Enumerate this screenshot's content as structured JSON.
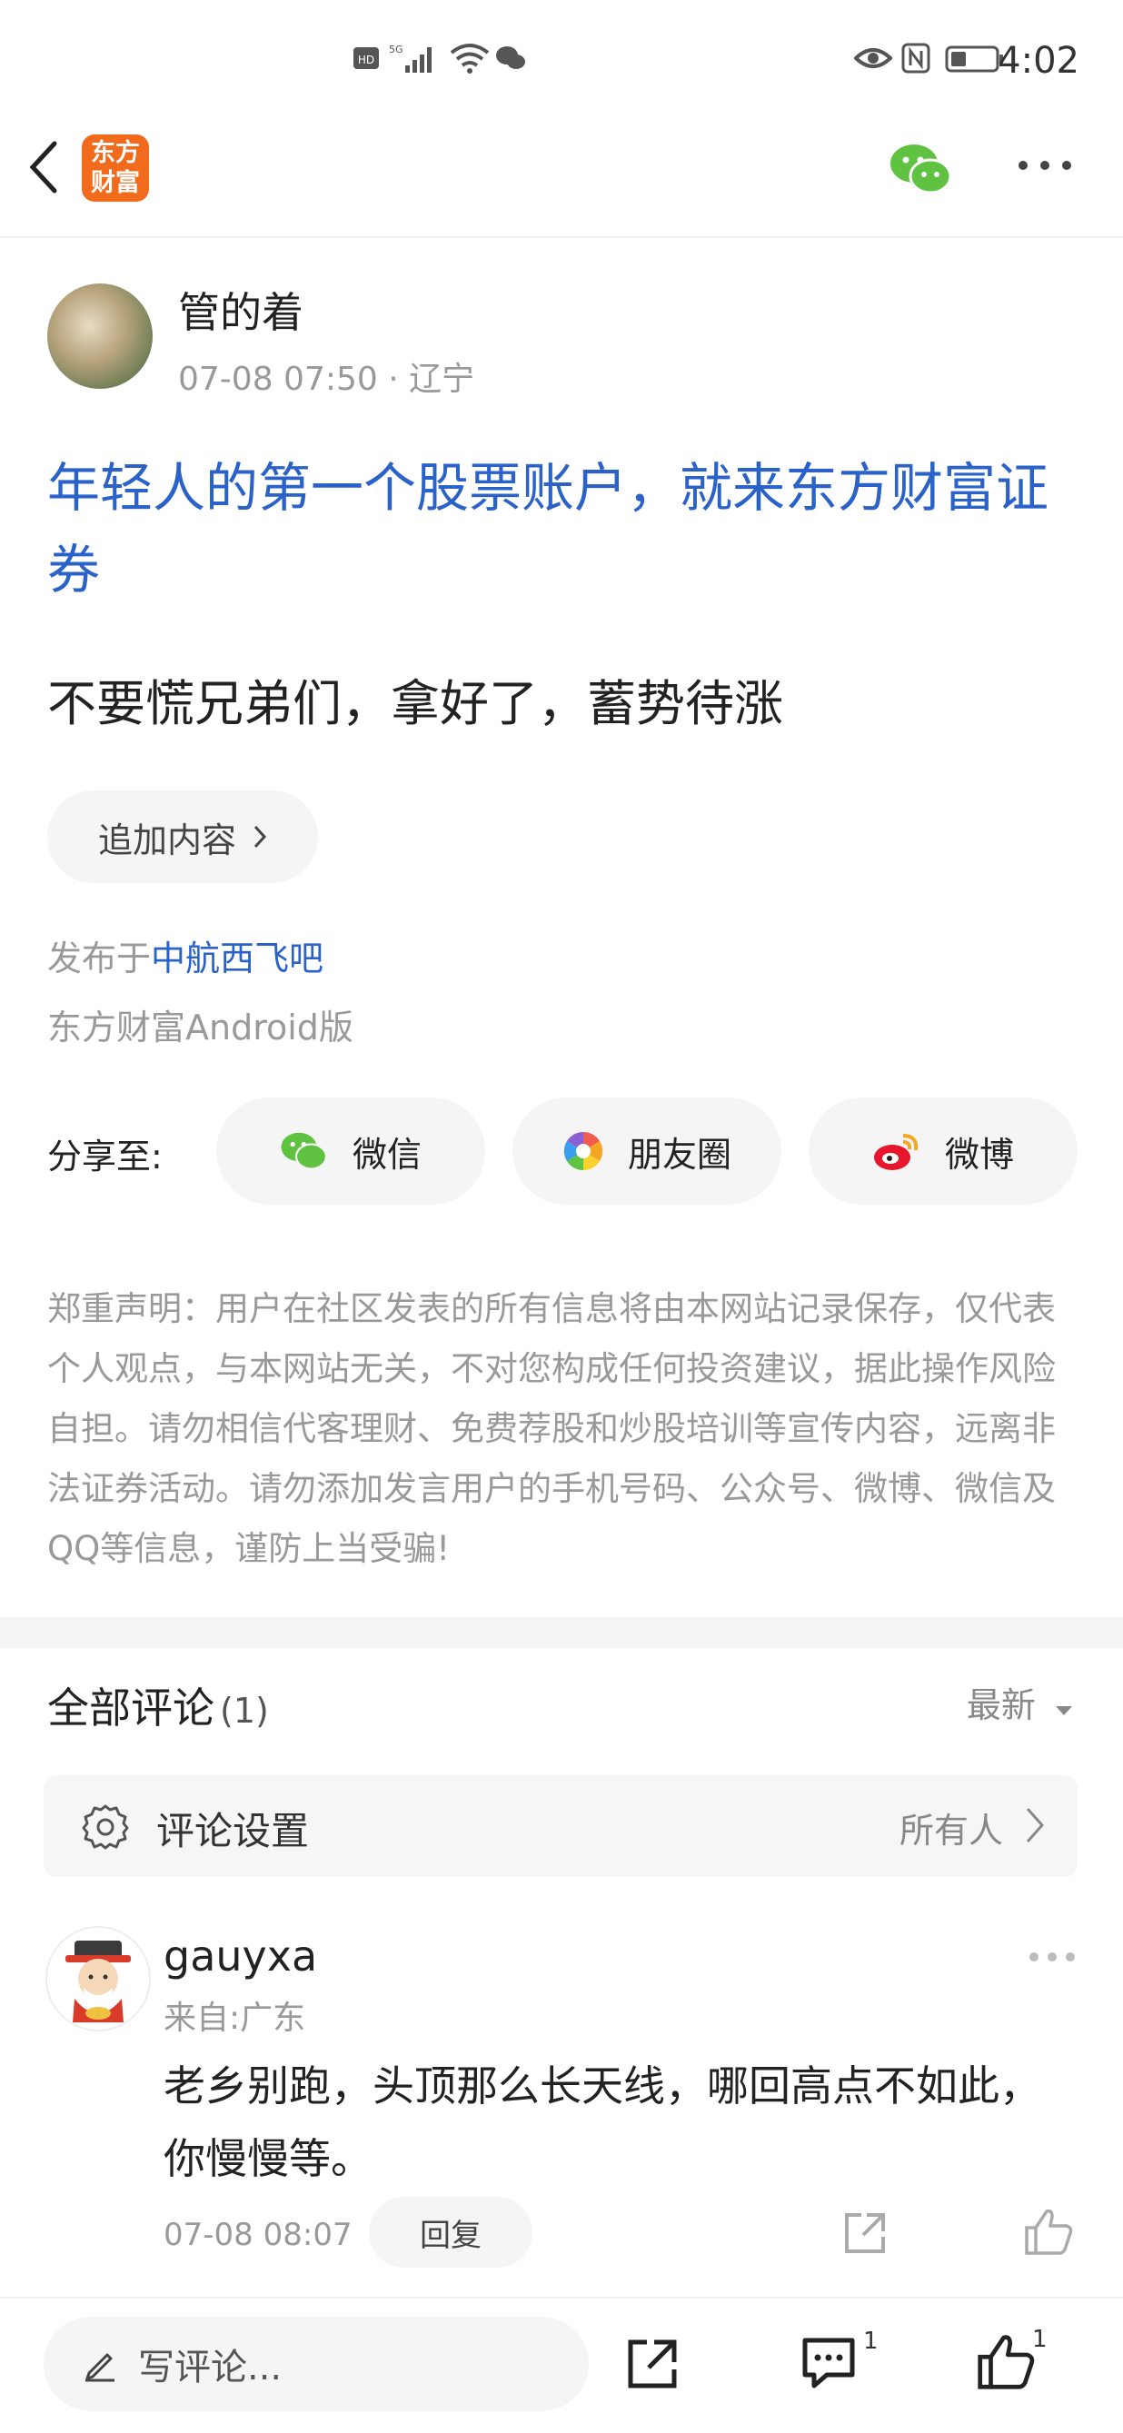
{
  "status_bar": {
    "time": "4:02",
    "network": "5G"
  },
  "header": {
    "logo_line1": "东方",
    "logo_line2": "财富",
    "back_icon": "chevron-left-icon",
    "wechat_icon": "wechat-icon",
    "more_icon": "more-horizontal-icon"
  },
  "post": {
    "author": "管的着",
    "time": "07-08 07:50",
    "location": "辽宁",
    "title": "年轻人的第一个股票账户，就来东方财富证券",
    "body": "不要慌兄弟们，拿好了，蓄势待涨",
    "add_content_label": "追加内容",
    "published_prefix": "发布于",
    "forum": "中航西飞吧",
    "client": "东方财富Android版"
  },
  "share": {
    "label": "分享至:",
    "wechat": "微信",
    "moments": "朋友圈",
    "weibo": "微博"
  },
  "disclaimer": "郑重声明：用户在社区发表的所有信息将由本网站记录保存，仅代表个人观点，与本网站无关，不对您构成任何投资建议，据此操作风险自担。请勿相信代客理财、免费荐股和炒股培训等宣传内容，远离非法证券活动。请勿添加发言用户的手机号码、公众号、微博、微信及QQ等信息，谨防上当受骗!",
  "comments": {
    "title": "全部评论",
    "count": "(1)",
    "sort": "最新",
    "settings_label": "评论设置",
    "settings_value": "所有人",
    "items": [
      {
        "user": "gauyxa",
        "from": "来自:广东",
        "text": "老乡别跑，头顶那么长天线，哪回高点不如此，你慢慢等。",
        "time": "07-08 08:07",
        "reply_label": "回复"
      }
    ]
  },
  "bottom_bar": {
    "write_placeholder": "写评论...",
    "comment_count": "1",
    "like_count": "1"
  }
}
